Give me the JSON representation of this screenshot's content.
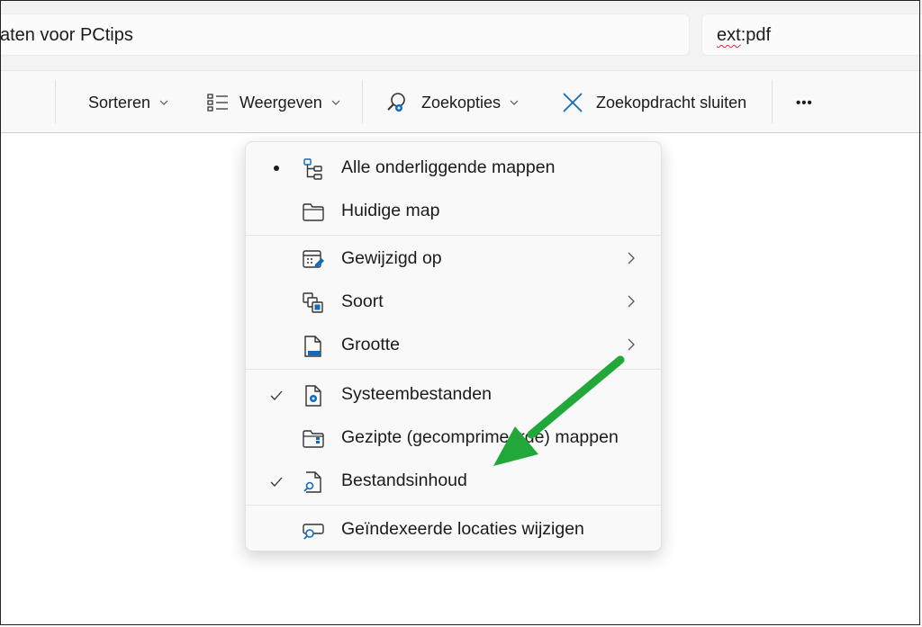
{
  "address_bar": {
    "text": "aten voor PCtips"
  },
  "search_box": {
    "prefix": "ext",
    "suffix": ":pdf"
  },
  "toolbar": {
    "sort_label": "Sorteren",
    "view_label": "Weergeven",
    "search_options_label": "Zoekopties",
    "close_search_label": "Zoekopdracht sluiten",
    "more_label": "•••"
  },
  "menu": {
    "scope": [
      {
        "label": "Alle onderliggende mappen",
        "selected": true,
        "icon": "folder-tree-icon"
      },
      {
        "label": "Huidige map",
        "selected": false,
        "icon": "folder-icon"
      }
    ],
    "filters": [
      {
        "label": "Gewijzigd op",
        "icon": "calendar-edit-icon",
        "submenu": true
      },
      {
        "label": "Soort",
        "icon": "file-types-icon",
        "submenu": true
      },
      {
        "label": "Grootte",
        "icon": "file-size-icon",
        "submenu": true
      }
    ],
    "advanced": [
      {
        "label": "Systeembestanden",
        "checked": true,
        "icon": "system-file-icon"
      },
      {
        "label": "Gezipte (gecomprimeerde) mappen",
        "checked": false,
        "icon": "zip-folder-icon"
      },
      {
        "label": "Bestandsinhoud",
        "checked": true,
        "icon": "file-search-icon"
      }
    ],
    "footer": {
      "label": "Geïndexeerde locaties wijzigen",
      "icon": "indexed-locations-icon"
    }
  },
  "colors": {
    "accent": "#0f6cbd",
    "annotation_arrow": "#22a83a",
    "menu_background": "#f9f9f9"
  }
}
